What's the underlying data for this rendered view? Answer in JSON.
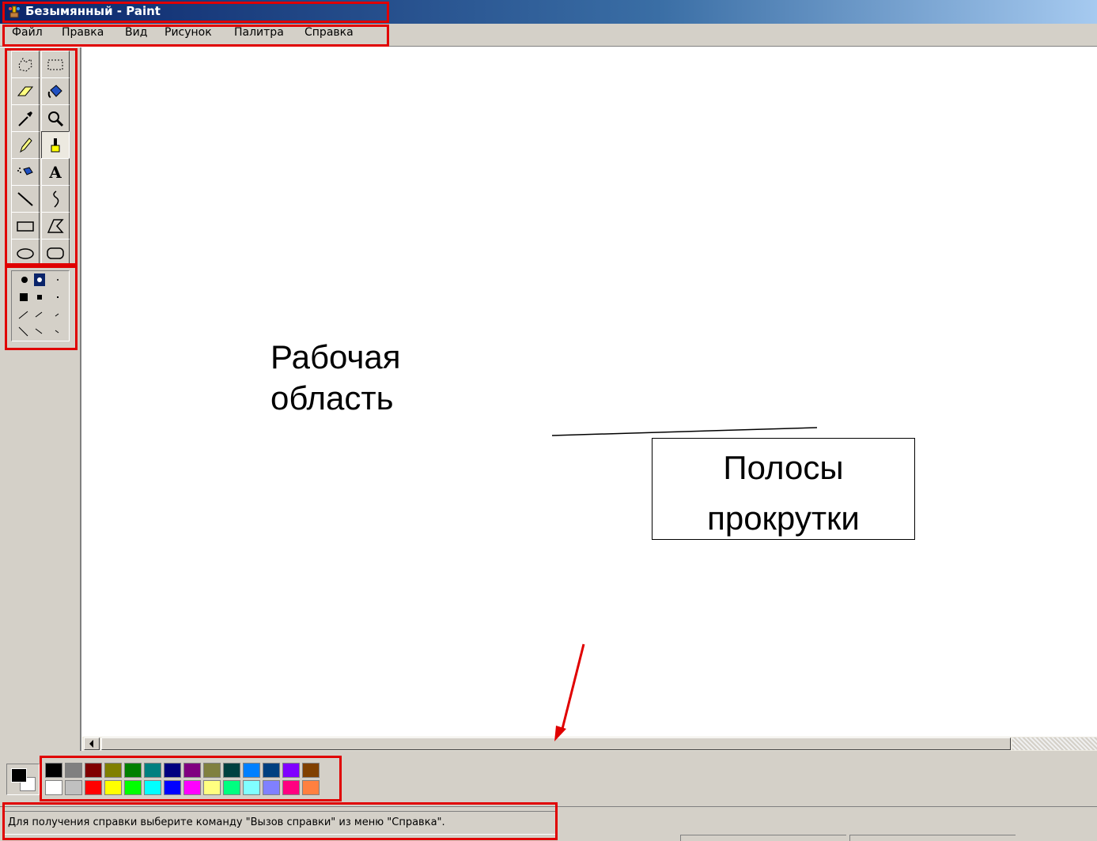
{
  "window": {
    "title": "Безымянный - Paint"
  },
  "menu": [
    "Файл",
    "Правка",
    "Вид",
    "Рисунок",
    "Палитра",
    "Справка"
  ],
  "tools": [
    {
      "name": "free-select-icon",
      "pressed": false
    },
    {
      "name": "rect-select-icon",
      "pressed": false
    },
    {
      "name": "eraser-icon",
      "pressed": false
    },
    {
      "name": "fill-icon",
      "pressed": false
    },
    {
      "name": "color-picker-icon",
      "pressed": false
    },
    {
      "name": "magnifier-icon",
      "pressed": false
    },
    {
      "name": "pencil-icon",
      "pressed": false
    },
    {
      "name": "brush-icon",
      "pressed": true
    },
    {
      "name": "airbrush-icon",
      "pressed": false
    },
    {
      "name": "text-icon",
      "pressed": false,
      "glyph": "A"
    },
    {
      "name": "line-icon",
      "pressed": false
    },
    {
      "name": "curve-icon",
      "pressed": false
    },
    {
      "name": "rectangle-icon",
      "pressed": false
    },
    {
      "name": "polygon-icon",
      "pressed": false
    },
    {
      "name": "ellipse-icon",
      "pressed": false
    },
    {
      "name": "rounded-rect-icon",
      "pressed": false
    }
  ],
  "palette": {
    "foreground": "#000000",
    "background": "#ffffff",
    "row1": [
      "#000000",
      "#808080",
      "#800000",
      "#808000",
      "#008000",
      "#008080",
      "#000080",
      "#800080",
      "#808040",
      "#004040",
      "#0080ff",
      "#004080",
      "#8000ff",
      "#804000"
    ],
    "row2": [
      "#ffffff",
      "#c0c0c0",
      "#ff0000",
      "#ffff00",
      "#00ff00",
      "#00ffff",
      "#0000ff",
      "#ff00ff",
      "#ffff80",
      "#00ff80",
      "#80ffff",
      "#8080ff",
      "#ff0080",
      "#ff8040"
    ]
  },
  "status": {
    "text": "Для получения справки выберите команду \"Вызов справки\" из меню \"Справка\"."
  },
  "annotations": {
    "workspace": {
      "line1": "Рабочая",
      "line2": "область"
    },
    "scrollbars": {
      "line1": "Полосы",
      "line2": "прокрутки"
    }
  },
  "colors": {
    "highlight": "#e00000",
    "face": "#d4d0c8"
  }
}
